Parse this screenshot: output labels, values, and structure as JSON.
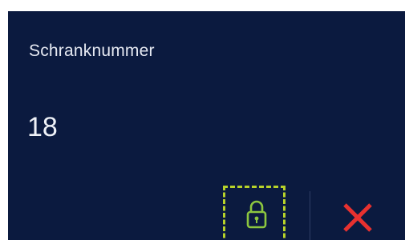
{
  "locker": {
    "label": "Schranknummer",
    "number": "18"
  },
  "actions": {
    "lock_icon": "lock-icon",
    "close_icon": "close-icon"
  },
  "colors": {
    "background": "#0b1a3f",
    "lock_accent": "#8cc63f",
    "focus_outline": "#b7d22a",
    "close_red": "#e8312f"
  }
}
